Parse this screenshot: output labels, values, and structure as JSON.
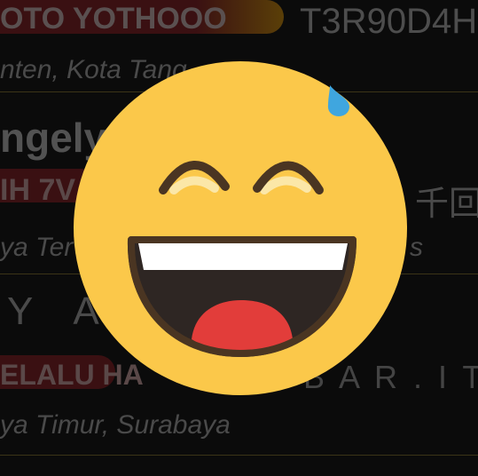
{
  "background_rows": [
    {
      "left": "OTO YOTHOOO",
      "right": "T3R90D4H"
    },
    {
      "text": "nten, Kota Tang"
    },
    {
      "text": "ngely"
    },
    {
      "left": "IH 7V",
      "right": "千回"
    },
    {
      "left": "ya Ter",
      "right": "s"
    },
    {
      "text": "Y A"
    },
    {
      "left": "ELALU HA",
      "right": "B A R . I T U"
    },
    {
      "text": "ya Timur, Surabaya"
    }
  ],
  "colors": {
    "emoji_face": "#fbc84a",
    "outline": "#4a3522",
    "teeth": "#ffffff",
    "mouth": "#2e2623",
    "tongue": "#e23d3a",
    "sweat": "#3fa6df",
    "pill_dark_red": "#3a1012",
    "pill_gold": "#3a2a08"
  },
  "icon": "laughing-sweat-emoji-icon"
}
